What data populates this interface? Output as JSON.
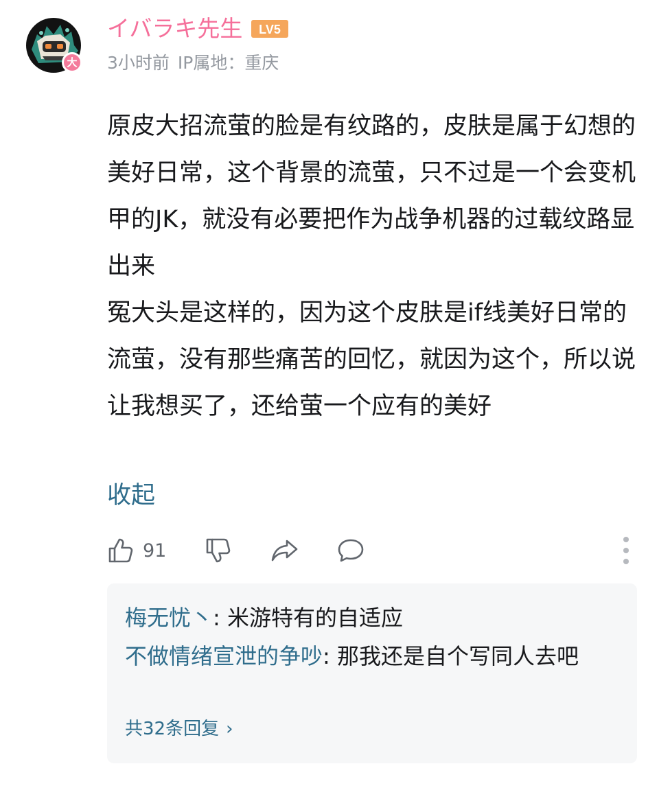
{
  "comment": {
    "author": {
      "name": "イバラキ先生",
      "level": "LV5",
      "avatar_badge": "大",
      "avatar_icon": "character-avatar-icon"
    },
    "meta": {
      "time": "3小时前",
      "ip_location": "IP属地：重庆"
    },
    "paragraphs": [
      "原皮大招流萤的脸是有纹路的，皮肤是属于幻想的美好日常，这个背景的流萤，只不过是一个会变机甲的JK，就没有必要把作为战争机器的过载纹路显出来",
      "冤大头是这样的，因为这个皮肤是if线美好日常的流萤，没有那些痛苦的回忆，就因为这个，所以说让我想买了，还给萤一个应有的美好"
    ],
    "collapse_label": "收起",
    "actions": {
      "like_count": "91",
      "like_icon": "thumbs-up-icon",
      "dislike_icon": "thumbs-down-icon",
      "share_icon": "share-icon",
      "reply_icon": "comment-icon",
      "more_icon": "more-vertical-icon"
    },
    "replies": [
      {
        "name": "梅无忧丶",
        "separator": ": ",
        "text": "米游特有的自适应"
      },
      {
        "name": "不做情绪宣泄的争吵",
        "separator": ": ",
        "text": "那我还是自个写同人去吧"
      }
    ],
    "view_more_label": "共32条回复",
    "view_more_chevron": "›"
  },
  "colors": {
    "username": "#f56f9a",
    "level_badge": "#f5a65b",
    "link": "#2f6d8c",
    "meta": "#9499a0",
    "reply_panel": "#f6f7f8"
  }
}
